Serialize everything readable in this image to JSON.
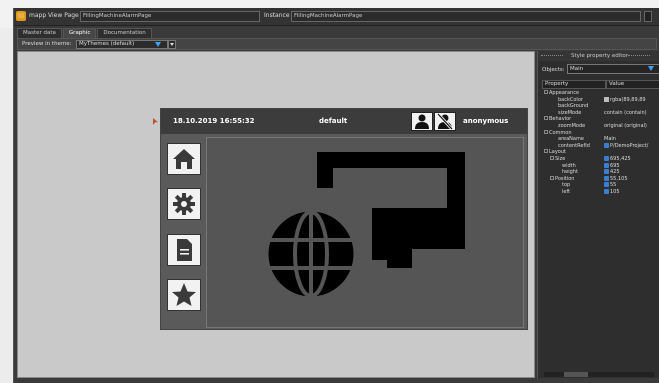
{
  "header": {
    "view_label": "mapp View Page",
    "view_value": "FillingMachineAlarmPage",
    "instance_label": "Instance",
    "instance_value": "FillingMachineAlarmPage"
  },
  "tabs": [
    "Master data",
    "Graphic",
    "Documentation"
  ],
  "active_tab": "Graphic",
  "themebar": {
    "label": "Preview in theme:",
    "selected": "MyThemes (default)"
  },
  "page": {
    "date": "18.10.2019 16:55:32",
    "theme": "default",
    "user": "anonymous",
    "side_buttons": [
      "home-icon",
      "gear-icon",
      "document-icon",
      "star-icon"
    ]
  },
  "property_editor": {
    "title": "Style property editor",
    "objects_label": "Objects:",
    "objects_value": "Main",
    "col_property": "Property",
    "col_value": "Value",
    "rows": [
      {
        "name": "Appearance",
        "group": true,
        "value": ""
      },
      {
        "name": "backColor",
        "group": false,
        "value": "rgba(89,89,89"
      },
      {
        "name": "backGround",
        "group": false,
        "value": ""
      },
      {
        "name": "sizeMode",
        "group": false,
        "value": "contain (contain)"
      },
      {
        "name": "Behavior",
        "group": true,
        "value": ""
      },
      {
        "name": "zoomMode",
        "group": false,
        "value": "original (original)"
      },
      {
        "name": "Common",
        "group": true,
        "value": ""
      },
      {
        "name": "areaName",
        "group": false,
        "value": "Main"
      },
      {
        "name": "contentRefId",
        "group": false,
        "value": "P/DemoProject/"
      },
      {
        "name": "Layout",
        "group": true,
        "value": ""
      },
      {
        "name": "Size",
        "group": true,
        "value": "695,425"
      },
      {
        "name": "width",
        "group": false,
        "value": "695"
      },
      {
        "name": "height",
        "group": false,
        "value": "425"
      },
      {
        "name": "Position",
        "group": true,
        "value": "55,105"
      },
      {
        "name": "top",
        "group": false,
        "value": "55"
      },
      {
        "name": "left",
        "group": false,
        "value": "105"
      }
    ]
  },
  "colors": {
    "accent": "#3fa0ff",
    "app_icon": "#e39a1a",
    "page_bg": "#5a5a5a"
  }
}
